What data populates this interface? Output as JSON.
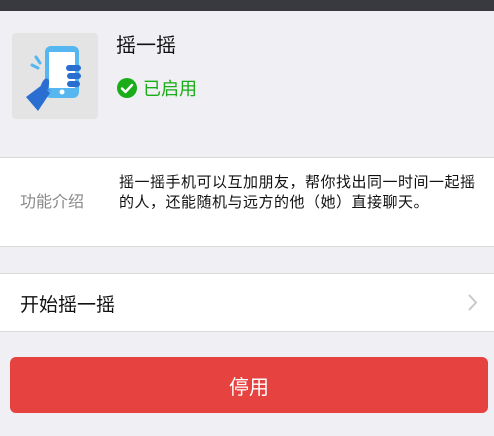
{
  "app": {
    "name": "摇一摇",
    "status": "已启用",
    "icon": "shake-phone-icon",
    "status_icon": "check-circle-icon",
    "status_color": "#1aad19"
  },
  "intro": {
    "label": "功能介绍",
    "text": "摇一摇手机可以互加朋友，帮你找出同一时间一起摇的人，还能随机与远方的他（她）直接聊天。"
  },
  "start": {
    "label": "开始摇一摇",
    "icon": "chevron-right-icon"
  },
  "disable_button": {
    "label": "停用",
    "color": "#e64340"
  }
}
